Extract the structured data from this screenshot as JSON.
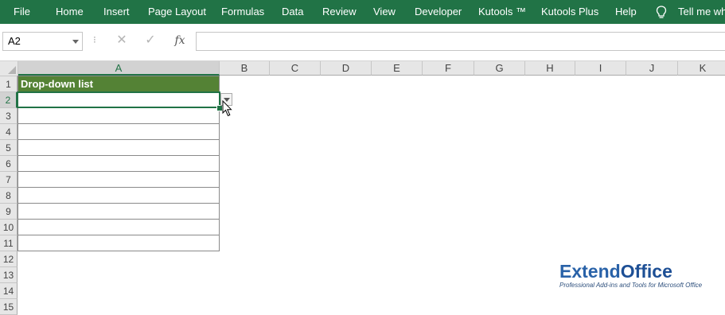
{
  "ribbon": {
    "tabs": [
      "File",
      "Home",
      "Insert",
      "Page Layout",
      "Formulas",
      "Data",
      "Review",
      "View",
      "Developer",
      "Kutools ™",
      "Kutools Plus",
      "Help"
    ],
    "tell_me": "Tell me wha",
    "color": "#217346"
  },
  "formula_bar": {
    "name_box": "A2",
    "separator": "⁝",
    "cancel_icon": "✕",
    "enter_icon": "✓",
    "fx_label": "fx",
    "formula": ""
  },
  "sheet": {
    "columns": [
      "A",
      "B",
      "C",
      "D",
      "E",
      "F",
      "G",
      "H",
      "I",
      "J",
      "K"
    ],
    "rows": [
      "1",
      "2",
      "3",
      "4",
      "5",
      "6",
      "7",
      "8",
      "9",
      "10",
      "11",
      "12",
      "13",
      "14",
      "15"
    ],
    "selected_cell": "A2",
    "header_cell": "Drop-down list",
    "header_fill": "#548235"
  },
  "watermark": {
    "brand_part1": "Extend",
    "brand_part2": "Office",
    "tagline": "Professional Add-ins and Tools for Microsoft Office"
  }
}
